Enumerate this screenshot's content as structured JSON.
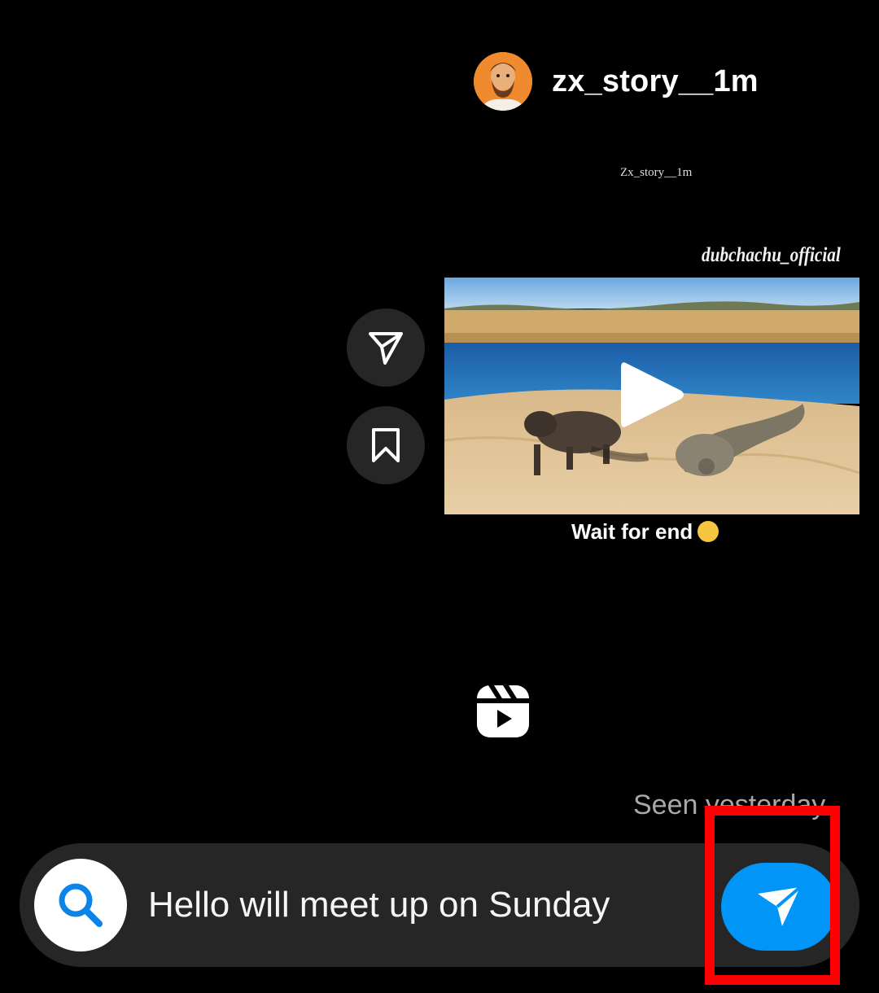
{
  "post": {
    "username": "zx_story__1m",
    "avatar_icon": "profile-avatar",
    "watermark": "Zx_story__1m",
    "channel_tag": "dubchachu_official",
    "video_caption": "Wait for end",
    "caption_emoji": "laughing-tears-emoji"
  },
  "actions": {
    "share_icon": "paper-plane-icon",
    "save_icon": "bookmark-icon",
    "reels_icon": "reels-icon"
  },
  "status": {
    "seen": "Seen yesterday"
  },
  "composer": {
    "search_icon": "search-icon",
    "message": "Hello will meet up on Sunday",
    "send_icon": "send-icon"
  },
  "colors": {
    "background": "#000000",
    "bubble": "#262626",
    "accent": "#0095f6",
    "highlight": "#ff0000",
    "muted_text": "#a8a8a8"
  }
}
